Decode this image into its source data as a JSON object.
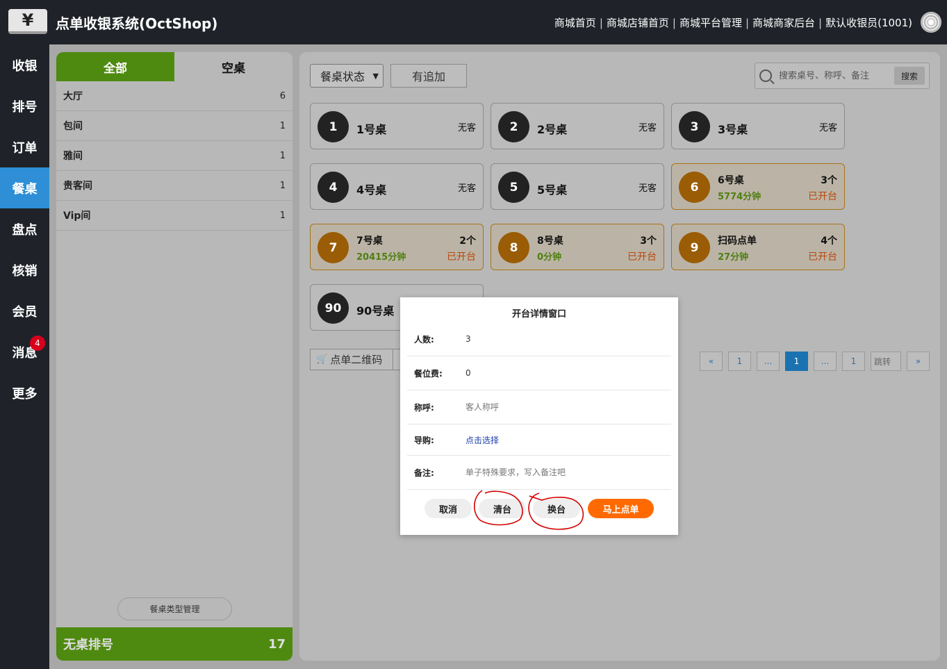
{
  "header": {
    "logo_glyph": "¥",
    "title": "点单收银系统(OctShop)",
    "nav": [
      "商城首页",
      "商城店铺首页",
      "商城平台管理",
      "商城商家后台",
      "默认收银员(1001)"
    ],
    "separator": "|"
  },
  "sidebar": {
    "items": [
      {
        "label": "收银"
      },
      {
        "label": "排号"
      },
      {
        "label": "订单"
      },
      {
        "label": "餐桌",
        "active": true
      },
      {
        "label": "盘点"
      },
      {
        "label": "核销"
      },
      {
        "label": "会员"
      },
      {
        "label": "消息",
        "badge": "4"
      },
      {
        "label": "更多"
      }
    ],
    "active_color": "#2e8fd6"
  },
  "categories": {
    "tabs": [
      "全部",
      "空桌"
    ],
    "rows": [
      {
        "name": "大厅",
        "count": "6"
      },
      {
        "name": "包间",
        "count": "1"
      },
      {
        "name": "雅间",
        "count": "1"
      },
      {
        "name": "贵客间",
        "count": "1"
      },
      {
        "name": "Vip间",
        "count": "1"
      }
    ],
    "manage_label": "餐桌类型管理",
    "no_table_label": "无桌排号",
    "no_table_count": "17",
    "accent": "#4f8a10"
  },
  "toolbar": {
    "status_select": "餐桌状态",
    "extra_label": "有追加",
    "search_placeholder": "搜索桌号、称呼、备注",
    "search_button": "搜索"
  },
  "tables": [
    {
      "num": "1",
      "name": "1号桌",
      "status": "无客"
    },
    {
      "num": "2",
      "name": "2号桌",
      "status": "无客"
    },
    {
      "num": "3",
      "name": "3号桌",
      "status": "无客"
    },
    {
      "num": "4",
      "name": "4号桌",
      "status": "无客"
    },
    {
      "num": "5",
      "name": "5号桌",
      "status": "无客"
    },
    {
      "num": "6",
      "name": "6号桌",
      "guests": "3个",
      "time": "5774分钟",
      "status": "已开台",
      "open": true
    },
    {
      "num": "7",
      "name": "7号桌",
      "guests": "2个",
      "time": "20415分钟",
      "status": "已开台",
      "open": true
    },
    {
      "num": "8",
      "name": "8号桌",
      "guests": "3个",
      "time": "0分钟",
      "status": "已开台",
      "open": true
    },
    {
      "num": "9",
      "name": "扫码点单",
      "guests": "4个",
      "time": "27分钟",
      "status": "已开台",
      "open": true
    },
    {
      "num": "90",
      "name": "90号桌",
      "status": ""
    }
  ],
  "bottom": {
    "qr_label": "点单二维码"
  },
  "pagination": {
    "prev": "«",
    "first": "1",
    "ellipsis": "...",
    "current": "1",
    "last": "1",
    "jump_placeholder": "跳转",
    "next": "»"
  },
  "modal": {
    "title": "开台详情窗口",
    "fields": {
      "people_label": "人数:",
      "people_value": "3",
      "seat_fee_label": "餐位费:",
      "seat_fee_value": "0",
      "name_label": "称呼:",
      "name_placeholder": "客人称呼",
      "guide_label": "导购:",
      "guide_link": "点击选择",
      "remark_label": "备注:",
      "remark_placeholder": "单子特殊要求，写入备注吧"
    },
    "buttons": {
      "cancel": "取消",
      "clear": "清台",
      "switch": "换台",
      "order_now": "马上点单"
    },
    "primary_color": "#ff6a00",
    "annotation_color": "#d40000"
  }
}
